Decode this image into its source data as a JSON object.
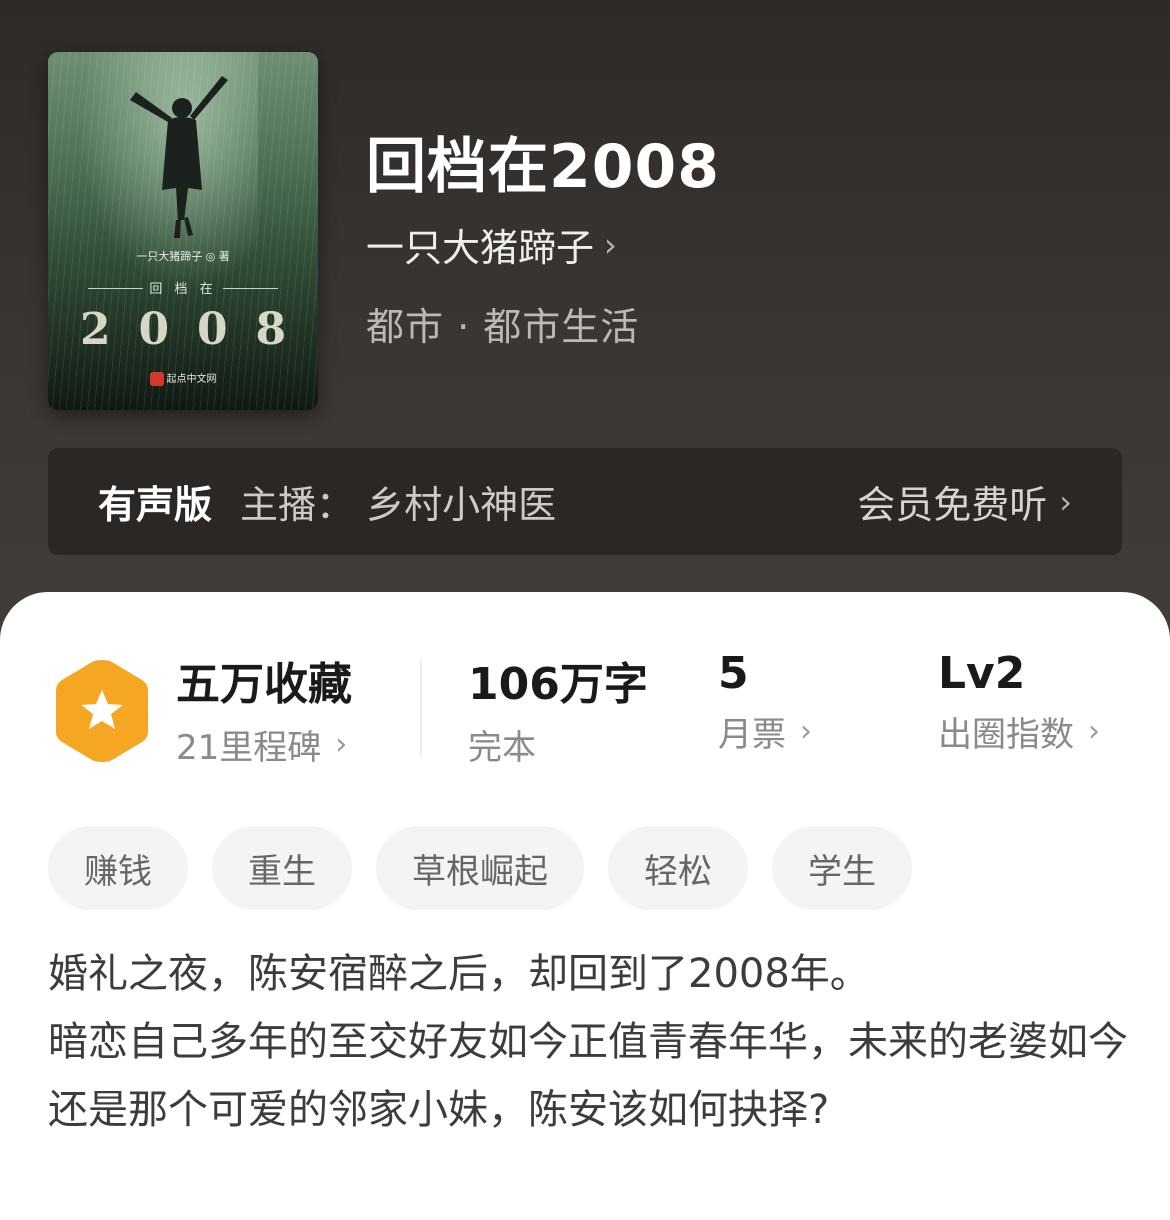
{
  "book": {
    "title": "回档在2008",
    "author": "一只大猪蹄子",
    "genre": "都市 · 都市生活",
    "cover": {
      "author_line": "一只大猪蹄子 ◎ 著",
      "subtitle": "回 档 在",
      "year_digits": [
        "2",
        "0",
        "0",
        "8"
      ],
      "publisher": "起点中文网"
    }
  },
  "audio": {
    "label": "有声版",
    "host": "主播：  乡村小神医",
    "free_link": "会员免费听"
  },
  "stats": {
    "collections": {
      "value": "五万收藏",
      "label": "21里程碑"
    },
    "words": {
      "value": "106万字",
      "label": "完本"
    },
    "monthly_tickets": {
      "value": "5",
      "label": "月票"
    },
    "popularity": {
      "value": "Lv2",
      "label": "出圈指数"
    }
  },
  "tags": [
    "赚钱",
    "重生",
    "草根崛起",
    "轻松",
    "学生"
  ],
  "description": [
    "婚礼之夜，陈安宿醉之后，却回到了2008年。",
    "暗恋自己多年的至交好友如今正值青春年华，未来的老婆如今还是那个可爱的邻家小妹，陈安该如何抉择?"
  ],
  "icons": {
    "chevron": "chevron-right-icon",
    "badge": "star-hexagon-icon"
  },
  "colors": {
    "badge": "#f5a623",
    "header_bg": "#3a3634"
  }
}
